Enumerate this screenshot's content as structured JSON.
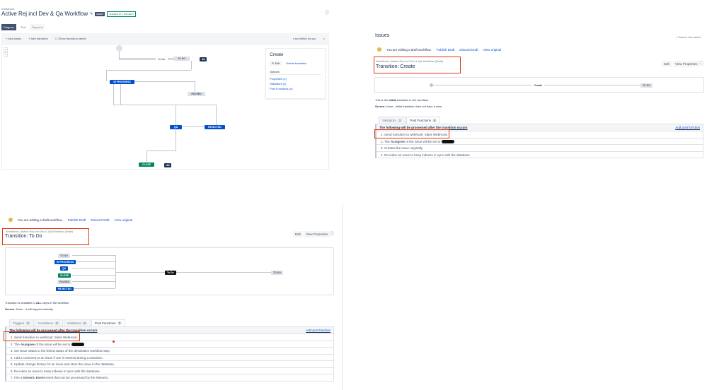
{
  "editor": {
    "breadcrumb": "Workflows",
    "title": "Active Rej incl Dev & Qa Workflow",
    "draft_badge": "DRAFT",
    "shared_badge": "SHARED BY 1 PROJECT",
    "view_tabs": [
      "Diagram",
      "Text",
      "Export ▾"
    ],
    "toolbar": {
      "add_status": "+ Add status",
      "add_transition": "+ Add transition",
      "show_labels": "Show transition labels",
      "last_edited": "Last edited by you"
    },
    "zoom_in": "+",
    "zoom_out": "−",
    "nodes": {
      "create": "Create",
      "todo": "TO DO",
      "in_progress": "IN PROGRESS",
      "paused": "PAUSED",
      "qa": "QA",
      "rejected": "REJECTED",
      "close": "CLOSE",
      "all1": "All",
      "all2": "All"
    },
    "panel": {
      "title": "Create",
      "edit": "✎ Edit",
      "delete": "Delete transition",
      "options_label": "Options",
      "properties": "Properties (1)",
      "validators": "Validators (1)",
      "post_functions": "Post Functions (4)"
    }
  },
  "create_view": {
    "app_title": "Issues",
    "search": "Search Jira admin",
    "banner": {
      "text": "You are editing a draft workflow.",
      "publish": "Publish Draft",
      "discard": "Discard Draft",
      "view_original": "View original"
    },
    "breadcrumb": "Workflows / Active Rej incl Dev & Qa Workflow (Draft)",
    "title": "Transition: Create",
    "edit": "Edit",
    "view_properties": "View Properties",
    "diagram": {
      "label": "Create",
      "target": "TO DO"
    },
    "desc_pre": "This is the ",
    "desc_bold": "initial",
    "desc_post": " transition in the workflow.",
    "screen_label": "Screen:",
    "screen_value": " None - initial transition does not have a view.",
    "tabs": [
      {
        "label": "Validators",
        "count": "1"
      },
      {
        "label": "Post Functions",
        "count": "4"
      }
    ],
    "pf_header": "The following will be processed after the transition occurs",
    "add_pf": "Add post function",
    "rows": [
      "1.  Send transition to webhook: Slack WebHook.",
      "2.  The ",
      "3.  Creates the issue originally.",
      "4.  Re-index an issue to keep indexes in sync with the database."
    ],
    "assignee_bold": "Assignee",
    "assignee_post": " of the issue will be set to"
  },
  "todo_view": {
    "banner": {
      "text": "You are editing a draft workflow.",
      "publish": "Publish Draft",
      "discard": "Discard Draft",
      "view_original": "View original"
    },
    "breadcrumb": "Workflows / Active Rej incl Dev & Qa Workflow (Draft)",
    "title": "Transition: To Do",
    "edit": "Edit",
    "view_properties": "View Properties",
    "sources": [
      "TO DO",
      "IN PROGRESS",
      "QA",
      "CLOSE",
      "PAUSED",
      "REJECTED"
    ],
    "diagram": {
      "label": "To Do",
      "target": "TO DO"
    },
    "desc_pre": "Transition is available to ",
    "desc_bold": "ALL",
    "desc_post": " steps in the workflow.",
    "screen_label": "Screen:",
    "screen_value": " None - it will happen instantly",
    "tabs": [
      {
        "label": "Triggers",
        "count": "0"
      },
      {
        "label": "Conditions",
        "count": "0"
      },
      {
        "label": "Validators",
        "count": "0"
      },
      {
        "label": "Post Functions",
        "count": "7"
      }
    ],
    "pf_header": "The following will be processed after the transition occurs",
    "add_pf": "Add post function",
    "rows": [
      "1.  Send transition to webhook: Slack WebHook.",
      "2.  The ",
      "3.  Set issue status to the linked status of the destination workflow step.",
      "4.  Add a comment to an issue if one is entered during a transition.",
      "5.  Update change history for an issue and store the issue in the database.",
      "6.  Re-index an issue to keep indexes in sync with the database.",
      "7.  Fire a "
    ],
    "assignee_bold": "Assignee",
    "assignee_post": " of the issue will be set to",
    "event_bold": "Generic Event",
    "event_post": " event that can be processed by the listeners."
  }
}
